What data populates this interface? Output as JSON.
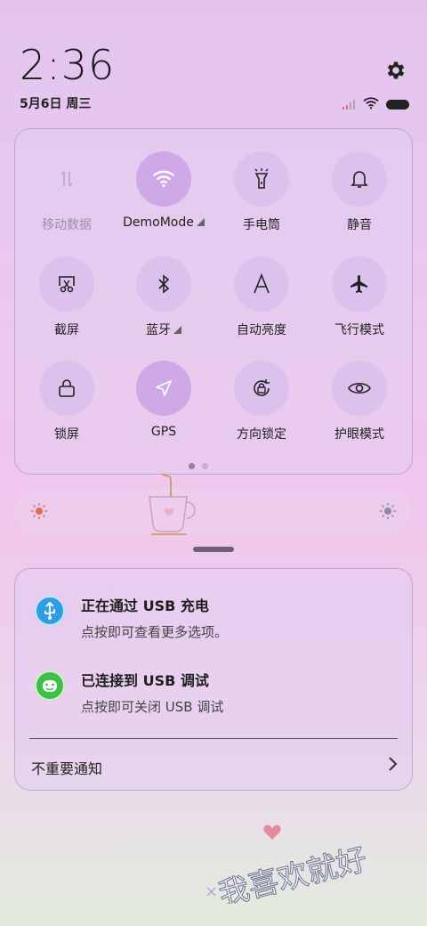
{
  "status_bar": {
    "time": "2:36",
    "date": "5月6日 周三",
    "icons": [
      "settings-icon",
      "signal-icon",
      "wifi-icon",
      "battery-icon"
    ]
  },
  "quick_settings": {
    "tiles": [
      {
        "id": "mobile-data",
        "label": "移动数据",
        "icon": "mobile-data-icon",
        "state": "disabled"
      },
      {
        "id": "wifi",
        "label": "DemoMode",
        "icon": "wifi-icon",
        "state": "on",
        "has_more": true
      },
      {
        "id": "flashlight",
        "label": "手电筒",
        "icon": "flashlight-icon",
        "state": "off"
      },
      {
        "id": "mute",
        "label": "静音",
        "icon": "bell-icon",
        "state": "off"
      },
      {
        "id": "screenshot",
        "label": "截屏",
        "icon": "screenshot-icon",
        "state": "off"
      },
      {
        "id": "bluetooth",
        "label": "蓝牙",
        "icon": "bluetooth-icon",
        "state": "off",
        "has_more": true
      },
      {
        "id": "auto-brightness",
        "label": "自动亮度",
        "icon": "auto-brightness-icon",
        "state": "off"
      },
      {
        "id": "airplane",
        "label": "飞行模式",
        "icon": "airplane-icon",
        "state": "off"
      },
      {
        "id": "lock",
        "label": "锁屏",
        "icon": "lock-icon",
        "state": "off"
      },
      {
        "id": "gps",
        "label": "GPS",
        "icon": "location-icon",
        "state": "on"
      },
      {
        "id": "rotation-lock",
        "label": "方向锁定",
        "icon": "rotation-lock-icon",
        "state": "off"
      },
      {
        "id": "eye-care",
        "label": "护眼模式",
        "icon": "eye-icon",
        "state": "off"
      }
    ],
    "page_count": 2,
    "current_page": 1
  },
  "brightness": {
    "icons": [
      "sun-low-icon",
      "sun-high-icon"
    ]
  },
  "notifications": [
    {
      "title": "正在通过 USB 充电",
      "text": "点按即可查看更多选项。",
      "icon": "usb-icon",
      "color": "#2f9de0"
    },
    {
      "title": "已连接到 USB 调试",
      "text": "点按即可关闭 USB 调试",
      "icon": "android-debug-icon",
      "color": "#3fbf4a"
    }
  ],
  "minor_notifications": {
    "label": "不重要通知"
  },
  "wallpaper_text": "我喜欢就好"
}
